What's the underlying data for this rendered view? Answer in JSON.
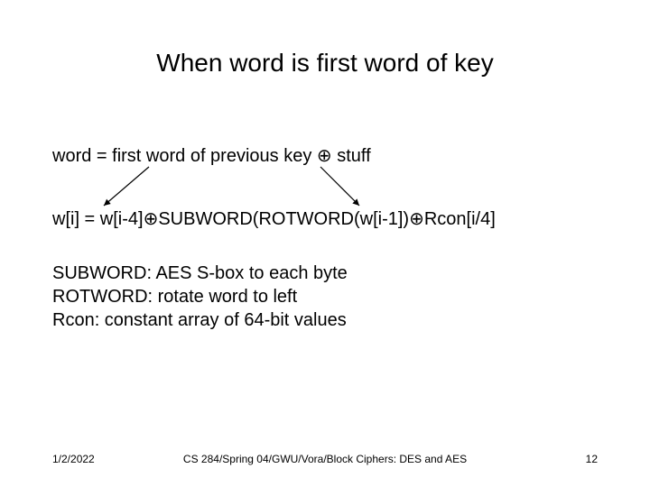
{
  "title": "When word is first word of key",
  "line1": "word = first word of previous key ⊕ stuff",
  "formula": "w[i] = w[i-4]⊕SUBWORD(ROTWORD(w[i-1])⊕Rcon[i/4]",
  "subword": "SUBWORD: AES S-box to each byte",
  "rotword": "ROTWORD: rotate word to left",
  "rcon": "Rcon: constant array of 64-bit values",
  "footer": {
    "date": "1/2/2022",
    "course": "CS 284/Spring 04/GWU/Vora/Block Ciphers: DES and AES",
    "page": "12"
  }
}
